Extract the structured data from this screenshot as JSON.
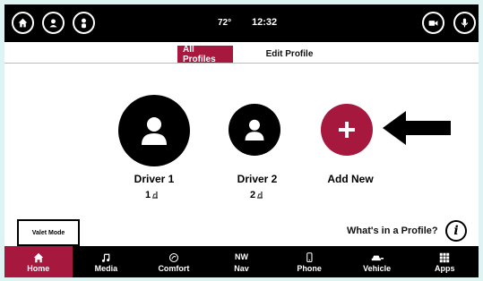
{
  "status": {
    "temperature": "72°",
    "time": "12:32"
  },
  "tabs": {
    "all_profiles": "All Profiles",
    "edit_profile": "Edit Profile"
  },
  "profiles": [
    {
      "name": "Driver 1",
      "seat": "1"
    },
    {
      "name": "Driver 2",
      "seat": "2"
    }
  ],
  "add_new": {
    "label": "Add New"
  },
  "valet": {
    "label": "Valet Mode"
  },
  "help": {
    "text": "What's in a Profile?",
    "info_glyph": "i"
  },
  "nav": [
    {
      "label": "Home",
      "icon": "home-icon"
    },
    {
      "label": "Media",
      "icon": "music-note-icon"
    },
    {
      "label": "Comfort",
      "icon": "climate-icon"
    },
    {
      "label": "Nav",
      "icon": "compass-icon",
      "glyph": "NW"
    },
    {
      "label": "Phone",
      "icon": "phone-icon"
    },
    {
      "label": "Vehicle",
      "icon": "car-icon"
    },
    {
      "label": "Apps",
      "icon": "apps-grid-icon"
    }
  ],
  "colors": {
    "accent": "#a6183d",
    "bar": "#000000",
    "frame": "#dff3f3"
  }
}
